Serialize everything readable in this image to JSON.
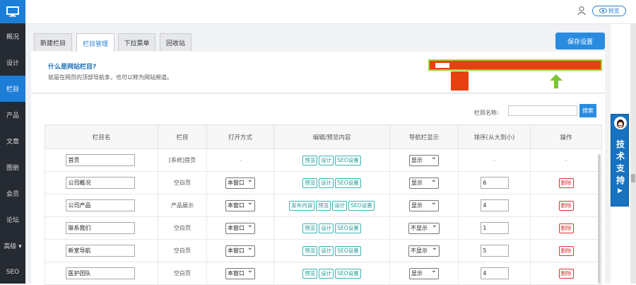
{
  "sidebar": {
    "items": [
      {
        "label": "概况"
      },
      {
        "label": "设计"
      },
      {
        "label": "栏目",
        "active": true
      },
      {
        "label": "产品"
      },
      {
        "label": "文章"
      },
      {
        "label": "图册"
      },
      {
        "label": "会员"
      },
      {
        "label": "论坛"
      },
      {
        "label": "高级 ▾"
      },
      {
        "label": "SEO"
      }
    ]
  },
  "topbar": {
    "preview_label": "预览"
  },
  "tabs": [
    {
      "label": "新建栏目"
    },
    {
      "label": "栏目管理",
      "active": true
    },
    {
      "label": "下拉菜单"
    },
    {
      "label": "回收站"
    }
  ],
  "save_label": "保存设置",
  "info": {
    "title": "什么是网站栏目?",
    "desc": "就是在网页的顶部导航条，也可以称为网站频道。"
  },
  "search": {
    "label": "栏目名称:",
    "button": "搜索",
    "value": ""
  },
  "table": {
    "headers": [
      "栏目名",
      "栏目",
      "打开方式",
      "编辑/预览内容",
      "导航栏显示",
      "排序(从大到小)",
      "操作"
    ],
    "rows": [
      {
        "name": "首页",
        "type": "[系统]首页",
        "open": "-",
        "actions": [
          "预览",
          "设计",
          "SEO设置"
        ],
        "nav": "显示",
        "sort": "-",
        "op": "-"
      },
      {
        "name": "公司概况",
        "type": "空白页",
        "open": "本窗口",
        "actions": [
          "预览",
          "设计",
          "SEO设置"
        ],
        "nav": "显示",
        "sort": "6",
        "op": "删除"
      },
      {
        "name": "公司产品",
        "type": "产品展示",
        "open": "本窗口",
        "actions": [
          "发布内容",
          "预览",
          "设计",
          "SEO设置"
        ],
        "nav": "显示",
        "sort": "4",
        "op": "删除"
      },
      {
        "name": "联系我们",
        "type": "空白页",
        "open": "本窗口",
        "actions": [
          "预览",
          "设计",
          "SEO设置"
        ],
        "nav": "不显示",
        "sort": "1",
        "op": "删除"
      },
      {
        "name": "新室导航",
        "type": "空白页",
        "open": "本窗口",
        "actions": [
          "预览",
          "设计",
          "SEO设置"
        ],
        "nav": "不显示",
        "sort": "5",
        "op": "删除"
      },
      {
        "name": "医护团队",
        "type": "空白页",
        "open": "本窗口",
        "actions": [
          "预览",
          "设计",
          "SEO设置"
        ],
        "nav": "显示",
        "sort": "4",
        "op": "删除"
      }
    ]
  },
  "float_tab": {
    "label": "技术支持"
  },
  "colors": {
    "accent": "#2a8ce0",
    "sidebar": "#262b33",
    "danger": "#dd3333"
  }
}
